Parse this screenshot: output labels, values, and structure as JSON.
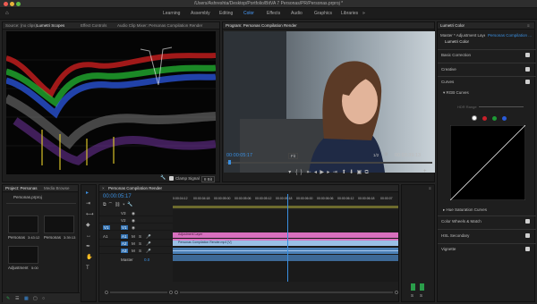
{
  "window": {
    "title": "/Users/Ashreshta/Desktop/Portfolio/BitVA 7 Personas/PR/Personas.prproj *"
  },
  "workspaces": [
    "Learning",
    "Assembly",
    "Editing",
    "Color",
    "Effects",
    "Audio",
    "Graphics",
    "Libraries"
  ],
  "active_workspace": "Color",
  "source_panel": {
    "tabs": [
      "Source: (no clips)",
      "Lumetri Scopes",
      "Effect Controls",
      "Audio Clip Mixer: Personas Compilation Render"
    ],
    "active_tab": "Lumetri Scopes",
    "clamp_signal": "Clamp Signal",
    "bit_depth": "8 Bit"
  },
  "program_monitor": {
    "title": "Program: Personas Compilation Render",
    "timecode": "00:00:05:17",
    "fit": "Fit",
    "resolution": "1/2",
    "duration": "00:03:39:13"
  },
  "lumetri": {
    "header": "Lumetri Color",
    "master_label": "Master * Adjustment Layer",
    "sequence_label": "Personas Compilation ...",
    "effect_label": "Lumetri Color",
    "sections": [
      "Basic Correction",
      "Creative",
      "Curves"
    ],
    "rgb_curves": "RGB Curves",
    "hdr_range": "HDR Range",
    "hue_sat": "Hue Saturation Curves",
    "bottom_sections": [
      "Color Wheels & Match",
      "HSL Secondary",
      "Vignette"
    ],
    "colors": {
      "white": "#ffffff",
      "red": "#c8202a",
      "green": "#1e9a35",
      "blue": "#2a5bd8"
    }
  },
  "project_panel": {
    "tabs": [
      "Project: Personas",
      "Media Browse"
    ],
    "filename": "Personas.prproj",
    "items": [
      {
        "name": "Personas C...",
        "duration": "3:43:12"
      },
      {
        "name": "Personas C...",
        "duration": "3:39:13"
      },
      {
        "name": "Adjustment La...",
        "duration": "5:00"
      }
    ]
  },
  "timeline": {
    "tab": "Personas Compilation Render",
    "timecode": "00:00:05:17",
    "ruler": [
      "0:00:04:12",
      "00:00:04:18",
      "00:00:05:00",
      "00:00:05:06",
      "00:00:05:12",
      "00:00:05:18",
      "00:00:06:00",
      "00:00:06:06",
      "00:00:06:12",
      "00:00:06:18",
      "00:00:07"
    ],
    "video_tracks": [
      "V3",
      "V2",
      "V1"
    ],
    "audio_tracks": [
      "A1",
      "A2",
      "A3"
    ],
    "source_patch_v": "V1",
    "source_patch_a": "A1",
    "master_label": "Master",
    "master_value": "0.0",
    "clips": {
      "v2": "Adjustment Layer",
      "v1": "Personas Compilation Render.mp4 [V]"
    }
  },
  "meter": {
    "labels": [
      "S",
      "S"
    ]
  }
}
